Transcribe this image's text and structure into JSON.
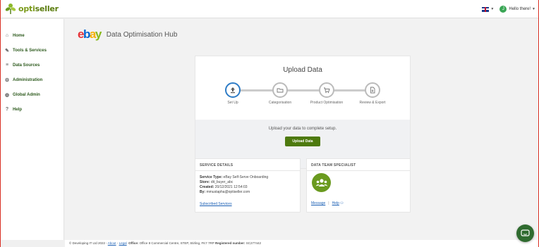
{
  "brand": {
    "name_part1": "opti",
    "name_part2": "seller"
  },
  "topbar": {
    "language_flag": "uk-flag-icon",
    "avatar_initial": "J",
    "greeting": "Hello there!"
  },
  "sidebar": {
    "items": [
      {
        "label": "Home",
        "icon": "home-icon"
      },
      {
        "label": "Tools & Services",
        "icon": "wrench-icon"
      },
      {
        "label": "Data Sources",
        "icon": "database-icon"
      },
      {
        "label": "Administration",
        "icon": "gear-icon"
      },
      {
        "label": "Global Admin",
        "icon": "globe-icon"
      },
      {
        "label": "Help",
        "icon": "question-icon"
      }
    ]
  },
  "hub": {
    "ebay_letters": [
      "e",
      "b",
      "a",
      "y"
    ],
    "title": "Data Optimisation Hub"
  },
  "upload": {
    "title": "Upload Data",
    "steps": [
      {
        "label": "Set Up",
        "icon": "upload-icon",
        "active": true
      },
      {
        "label": "Categorisation",
        "icon": "folder-icon",
        "active": false
      },
      {
        "label": "Product Optimisation",
        "icon": "cart-icon",
        "active": false
      },
      {
        "label": "Review & Export",
        "icon": "document-icon",
        "active": false
      }
    ],
    "prompt": "Upload your data to complete setup.",
    "button_label": "Upload Data"
  },
  "service_details": {
    "heading": "SERVICE DETAILS",
    "service_type_label": "Service Type:",
    "service_type_value": "eBay Self-Serve Onboarding",
    "store_label": "Store:",
    "store_value": "dit_buyer_abc",
    "created_label": "Created:",
    "created_value": "20/12/2021 12:54:03",
    "by_label": "By:",
    "by_value": "mmustapha@optiseller.com",
    "link": "Subscribed Services"
  },
  "team": {
    "heading": "DATA TEAM SPECIALIST",
    "message_link": "Message",
    "separator": "|",
    "help_link": "Help"
  },
  "footer": {
    "copyright": "© Developing IT Ltd 2022 -",
    "about": "About",
    "dash": "-",
    "legal": "Legal",
    "office_label": "Office:",
    "office_value": "Office 8 Commercial Centre, STEP, Stirling, FK7 7RP",
    "reg_label": "Registered number:",
    "reg_value": "SC277442"
  },
  "colors": {
    "brand_green": "#4e7a0e",
    "active_step": "#2e7cc6",
    "link_blue": "#1a5fb4",
    "chat_bubble": "#2f6b2f"
  }
}
